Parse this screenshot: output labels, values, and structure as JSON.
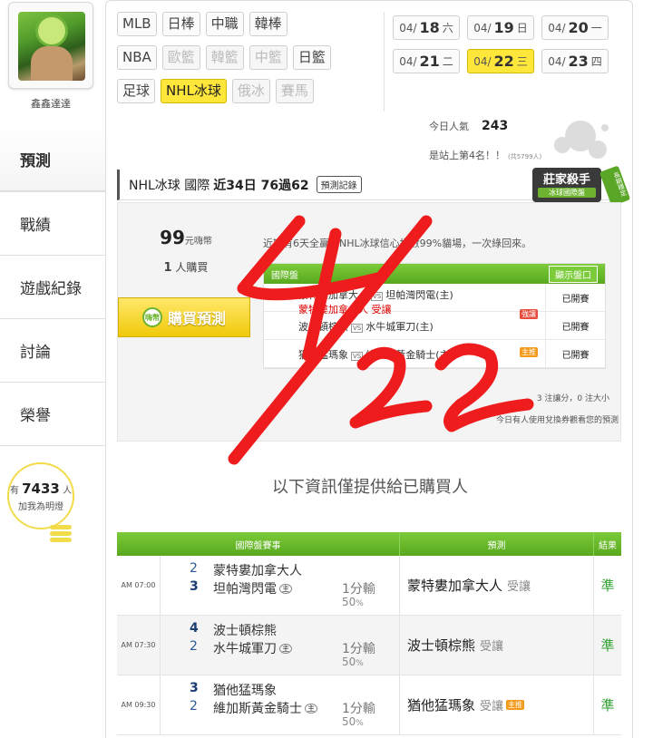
{
  "profile": {
    "username": "鑫鑫達達"
  },
  "nav": {
    "items": [
      "預測",
      "戰績",
      "遊戲紀錄",
      "討論",
      "榮譽"
    ]
  },
  "fans": {
    "prefix": "有",
    "count": "7433",
    "suffix": "人",
    "label": "加我為明燈"
  },
  "sports": {
    "row1": [
      "MLB",
      "日棒",
      "中職",
      "韓棒"
    ],
    "row2": [
      "NBA",
      "歐籃",
      "韓籃",
      "中籃",
      "日籃"
    ],
    "row3": [
      "足球",
      "NHL冰球",
      "俄冰",
      "賽馬"
    ]
  },
  "dates": [
    {
      "md": "04/",
      "day": "18",
      "wk": "六"
    },
    {
      "md": "04/",
      "day": "19",
      "wk": "日"
    },
    {
      "md": "04/",
      "day": "20",
      "wk": "一"
    },
    {
      "md": "04/",
      "day": "21",
      "wk": "二"
    },
    {
      "md": "04/",
      "day": "22",
      "wk": "三"
    },
    {
      "md": "04/",
      "day": "23",
      "wk": "四"
    }
  ],
  "stats": {
    "popularity_label": "今日人氣",
    "popularity_value": "243",
    "rank_text": "是站上第4名！！",
    "rank_total": "(共5799人)"
  },
  "banner": {
    "league": "NHL冰球 國際",
    "record": "近34日 76過62",
    "record_btn": "預測記錄"
  },
  "badge": {
    "title": "莊家殺手",
    "subtitle": "冰球國際盤",
    "ribbon": "長期穩定"
  },
  "purchase": {
    "price": "99",
    "price_unit": "元嗨幣",
    "buyers": "1",
    "buyers_unit": "人購買",
    "buy_label": "購買預測",
    "buy_icon": "嗨幣",
    "promo": "近期有6天全贏，NHL冰球信心指數99%貓場，一次綠回來。",
    "table_head": "國際盤",
    "show_btn": "顯示盤口",
    "rows": [
      {
        "away": "蒙特婁加拿大人",
        "home": "坦帕灣閃電(主)",
        "pick": "蒙特婁加拿大人 受讓",
        "tag": "強讓",
        "status": "已開賽"
      },
      {
        "away": "波士頓棕熊",
        "home": "水牛城軍刀(主)",
        "pick": "",
        "tag": "",
        "status": "已開賽"
      },
      {
        "away": "猶他猛瑪象",
        "home": "維加斯黃金騎士(主)",
        "pick": "",
        "tag": "主推",
        "status": "已開賽"
      }
    ],
    "summary": "3 注讓分，0 注大小",
    "exchange": "今日有人使用兌換券觀看您的預測"
  },
  "notice": "以下資訊僅提供給已購買人",
  "results": {
    "headers": [
      "國際盤賽事",
      "預測",
      "結果"
    ],
    "rows": [
      {
        "time": "AM 07:00",
        "s1": "2",
        "t1": "蒙特婁加拿大人",
        "s2": "3",
        "t2": "坦帕灣閃電",
        "home": "主",
        "line": "1分輸",
        "pct": "50",
        "pct_unit": "%",
        "pick": "蒙特婁加拿大人",
        "give": "受讓",
        "tag": "",
        "result": "準"
      },
      {
        "time": "AM 07:30",
        "s1": "4",
        "t1": "波士頓棕熊",
        "s2": "2",
        "t2": "水牛城軍刀",
        "home": "主",
        "line": "1分輸",
        "pct": "50",
        "pct_unit": "%",
        "pick": "波士頓棕熊",
        "give": "受讓",
        "tag": "",
        "result": "準"
      },
      {
        "time": "AM 09:30",
        "s1": "3",
        "t1": "猶他猛瑪象",
        "s2": "2",
        "t2": "維加斯黃金騎士",
        "home": "主",
        "line": "1分輸",
        "pct": "50",
        "pct_unit": "%",
        "pick": "猶他猛瑪象",
        "give": "受讓",
        "tag": "主推",
        "result": "準"
      }
    ]
  },
  "colors": {
    "accent_green": "#6db32f",
    "highlight_yellow": "#ffe63a",
    "scribble_red": "#ee1c1c"
  }
}
